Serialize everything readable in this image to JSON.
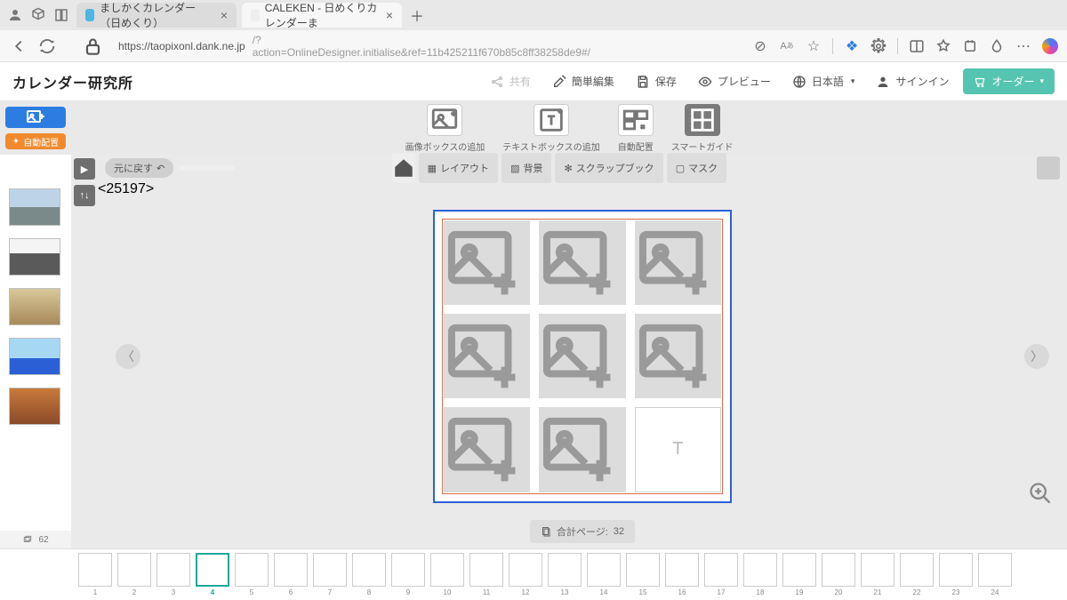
{
  "browser": {
    "tabs": [
      {
        "title": "ましかくカレンダー（日めくり）"
      },
      {
        "title": "CALEKEN - 日めくりカレンダーま"
      }
    ],
    "url_host": "https://taopixonl.dank.ne.jp",
    "url_path": "/?action=OnlineDesigner.initialise&ref=11b425211f670b85c8ff38258de9#/"
  },
  "app": {
    "logo": "カレンダー研究所",
    "share": "共有",
    "easy_edit": "簡単編集",
    "save": "保存",
    "preview": "プレビュー",
    "language": "日本語",
    "signin": "サインイン",
    "order": "オーダー"
  },
  "ribbon": {
    "add_image": "画像ボックスの追加",
    "add_text": "テキストボックスの追加",
    "auto_layout": "自動配置",
    "smart_guide": "スマートガイド",
    "side_auto": "自動配置"
  },
  "sec": {
    "undo": "元に戻す",
    "layout": "レイアウト",
    "background": "背景",
    "scrapbook": "スクラップブック",
    "mask": "マスク"
  },
  "canvas": {
    "text_placeholder": "T"
  },
  "footer": {
    "total_label": "合計ページ:",
    "total_value": "32"
  },
  "thumbs": {
    "count": "62"
  },
  "filmstrip": {
    "selected": 4,
    "pages": [
      "1",
      "2",
      "3",
      "4",
      "5",
      "6",
      "7",
      "8",
      "9",
      "10",
      "11",
      "12",
      "13",
      "14",
      "15",
      "16",
      "17",
      "18",
      "19",
      "20",
      "21",
      "22",
      "23",
      "24"
    ]
  }
}
